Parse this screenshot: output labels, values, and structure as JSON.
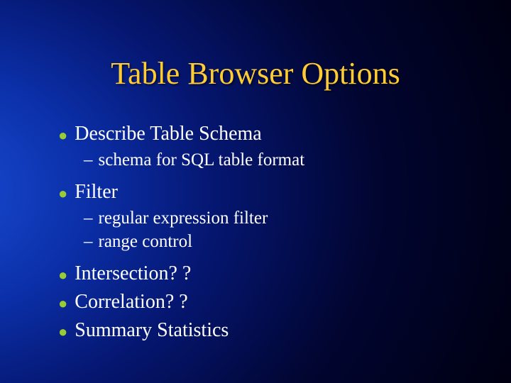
{
  "title": "Table Browser Options",
  "items": [
    {
      "label": "Describe Table Schema",
      "sub": [
        "schema for SQL table format"
      ]
    },
    {
      "label": "Filter",
      "sub": [
        "regular expression filter",
        "range control"
      ]
    },
    {
      "label": "Intersection? ?",
      "sub": []
    },
    {
      "label": "Correlation? ?",
      "sub": []
    },
    {
      "label": "Summary Statistics",
      "sub": []
    }
  ]
}
